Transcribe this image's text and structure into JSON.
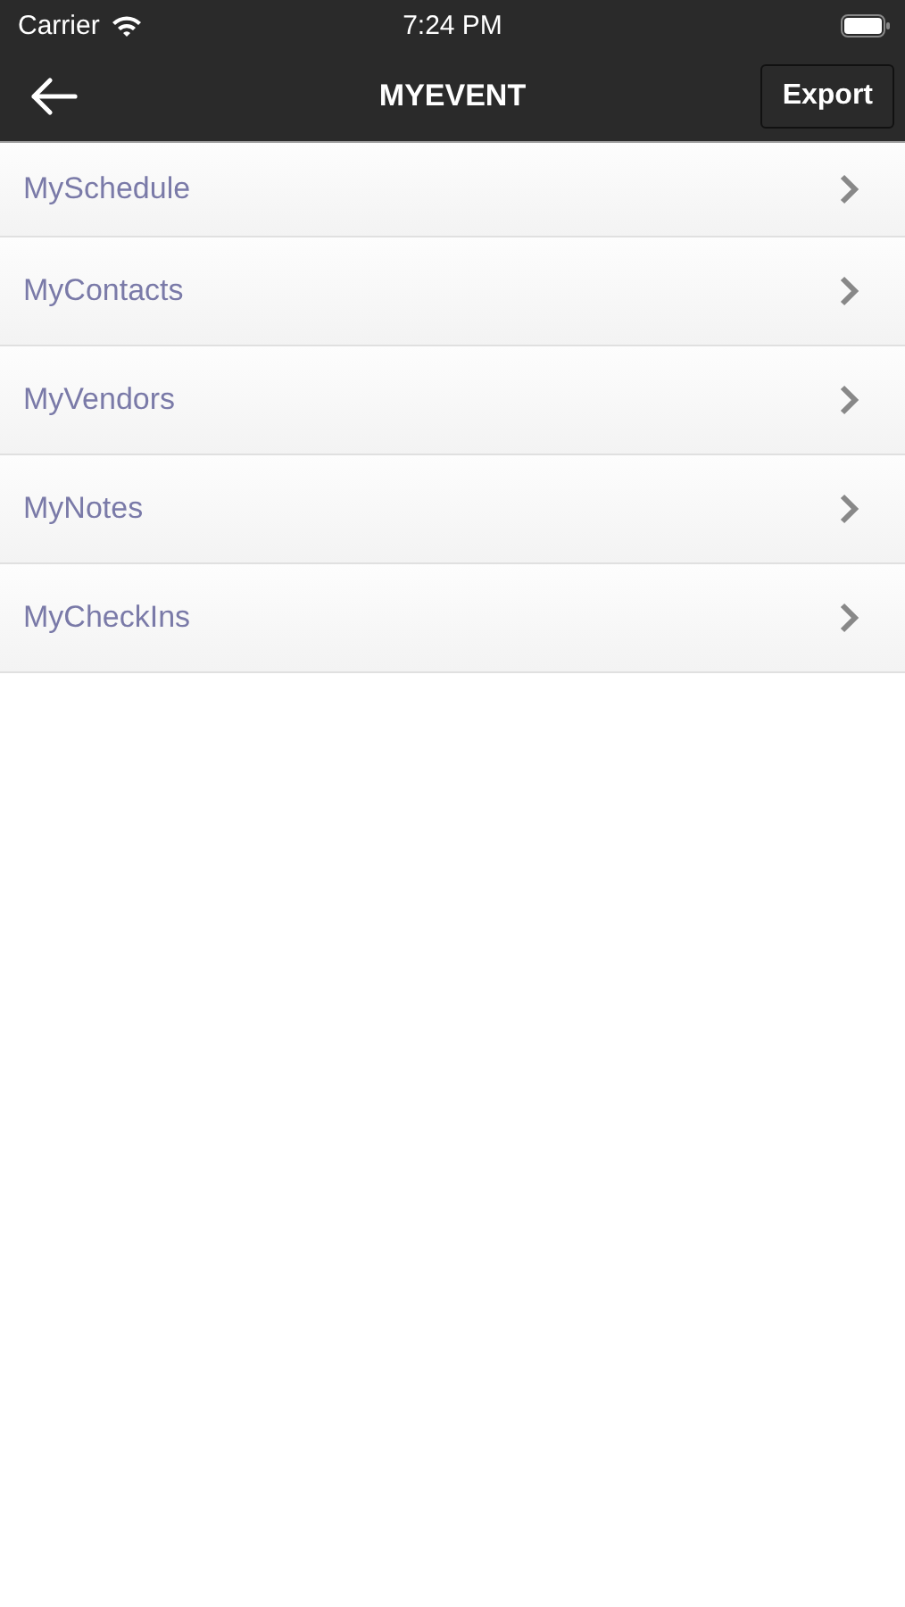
{
  "status_bar": {
    "carrier": "Carrier",
    "time": "7:24 PM"
  },
  "nav_bar": {
    "title": "MYEVENT",
    "export_button": "Export"
  },
  "menu_items": [
    {
      "label": "MySchedule"
    },
    {
      "label": "MyContacts"
    },
    {
      "label": "MyVendors"
    },
    {
      "label": "MyNotes"
    },
    {
      "label": "MyCheckIns"
    }
  ]
}
